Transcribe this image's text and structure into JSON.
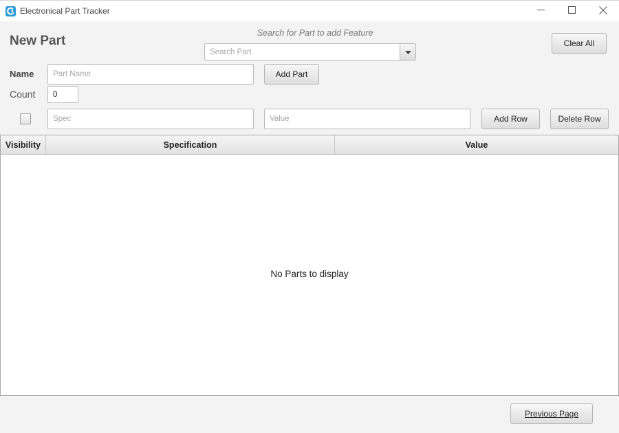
{
  "window": {
    "title": "Electronical Part Tracker",
    "minimize_icon": "minimize-icon",
    "maximize_icon": "maximize-icon",
    "close_icon": "close-icon"
  },
  "form": {
    "heading": "New Part",
    "search_hint": "Search for Part to add Feature",
    "search_placeholder": "Search Part",
    "clear_all_label": "Clear All",
    "name_label": "Name",
    "name_placeholder": "Part Name",
    "add_part_label": "Add Part",
    "count_label": "Count",
    "count_value": "0",
    "spec_placeholder": "Spec",
    "value_placeholder": "Value",
    "add_row_label": "Add Row",
    "delete_row_label": "Delete Row",
    "visibility_checked": false
  },
  "table": {
    "columns": [
      "Visibility",
      "Specification",
      "Value"
    ],
    "empty_message": "No Parts to display",
    "rows": []
  },
  "footer": {
    "previous_page_label": "Previous Page"
  },
  "colors": {
    "accent": "#2e9bd6",
    "background": "#f3f3f3"
  }
}
